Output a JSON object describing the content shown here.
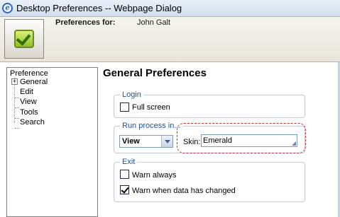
{
  "window": {
    "title": "Desktop Preferences -- Webpage Dialog",
    "icon": "ie-icon"
  },
  "header": {
    "logo_icon": "checkbox-logo-icon",
    "preferences_for_label": "Preferences for:",
    "user_name": "John Galt"
  },
  "tree": {
    "root": "Preference",
    "items": [
      {
        "label": "General",
        "expandable": true,
        "expander": "+"
      },
      {
        "label": "Edit"
      },
      {
        "label": "View"
      },
      {
        "label": "Tools"
      },
      {
        "label": "Search"
      }
    ]
  },
  "main": {
    "title": "General Preferences",
    "login": {
      "legend": "Login",
      "full_screen": {
        "label": "Full screen",
        "checked": false
      }
    },
    "run_process": {
      "legend": "Run process in...",
      "mode_value": "View",
      "skin_label": "Skin:",
      "skin_value": "Emerald"
    },
    "exit": {
      "legend": "Exit",
      "warn_always": {
        "label": "Warn always",
        "checked": false
      },
      "warn_changed": {
        "label": "Warn when data has changed",
        "checked": true
      }
    }
  },
  "colors": {
    "legend_text": "#1f4ea3",
    "highlight_border": "#c83232",
    "titlebar": "#d3deee"
  }
}
